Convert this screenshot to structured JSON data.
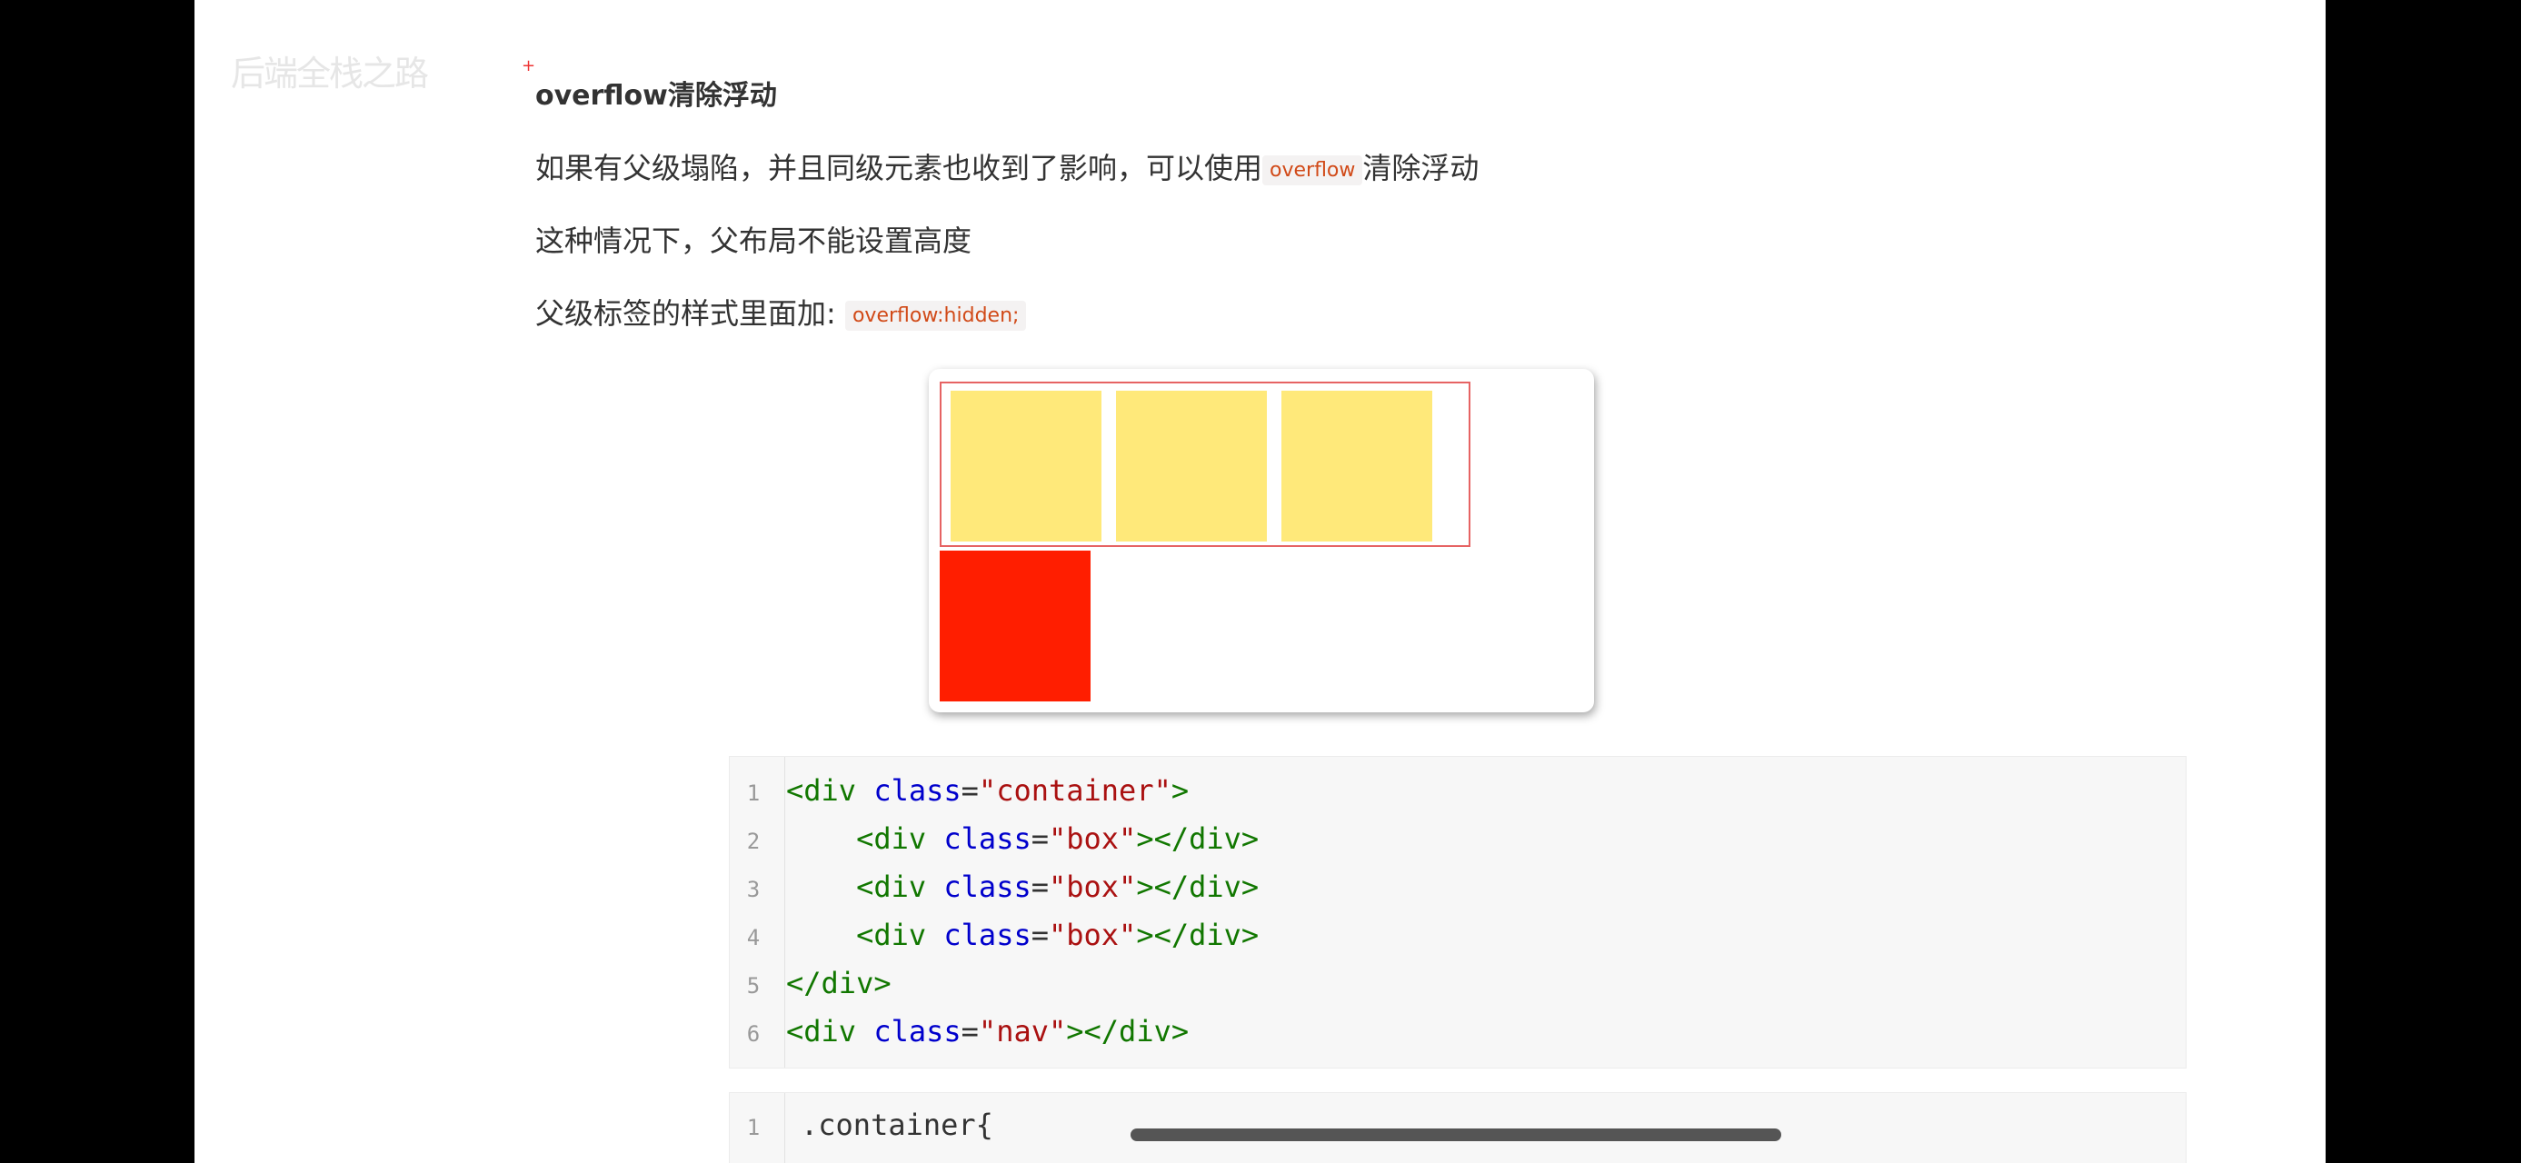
{
  "watermark": "后端全栈之路",
  "heading": "overflow清除浮动",
  "para1": {
    "before": "如果有父级塌陷，并且同级元素也收到了影响，可以使用",
    "code": "overflow",
    "after": "清除浮动"
  },
  "para2": "这种情况下，父布局不能设置高度",
  "para3": {
    "before": "父级标签的样式里面加:",
    "code": "overflow:hidden;"
  },
  "demo": {
    "box_color": "#ffe97a",
    "nav_color": "#ff1e00",
    "container_border": "#e66363"
  },
  "code1": [
    {
      "n": "1",
      "indent": "",
      "tag_open": "<div",
      "attr": "class",
      "eq": "=",
      "val": "\"container\"",
      "rest": ">"
    },
    {
      "n": "2",
      "indent": "    ",
      "tag_open": "<div",
      "attr": "class",
      "eq": "=",
      "val": "\"box\"",
      "rest": "></div>"
    },
    {
      "n": "3",
      "indent": "    ",
      "tag_open": "<div",
      "attr": "class",
      "eq": "=",
      "val": "\"box\"",
      "rest": "></div>"
    },
    {
      "n": "4",
      "indent": "    ",
      "tag_open": "<div",
      "attr": "class",
      "eq": "=",
      "val": "\"box\"",
      "rest": "></div>"
    },
    {
      "n": "5",
      "indent": "",
      "tag_open": "</div>",
      "attr": "",
      "eq": "",
      "val": "",
      "rest": ""
    },
    {
      "n": "6",
      "indent": "",
      "tag_open": "<div",
      "attr": "class",
      "eq": "=",
      "val": "\"nav\"",
      "rest": "></div>"
    }
  ],
  "code2": [
    {
      "n": "1",
      "text": ".container{"
    }
  ]
}
